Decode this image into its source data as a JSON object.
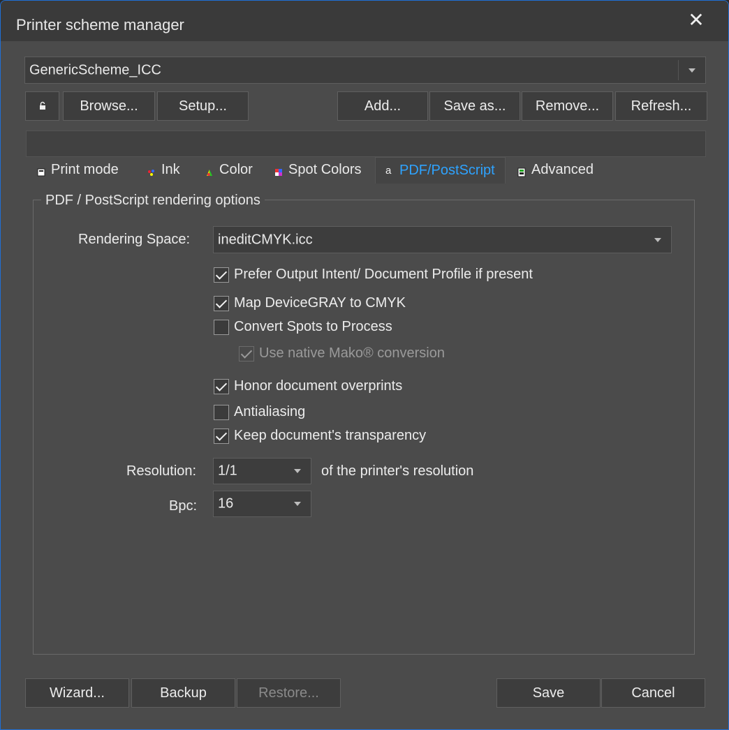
{
  "window": {
    "title": "Printer scheme manager",
    "close_glyph": "✕"
  },
  "scheme": {
    "selected": "GenericScheme_ICC"
  },
  "toolbar": {
    "lock_icon": "lock-icon",
    "browse": "Browse...",
    "setup": "Setup...",
    "add": "Add...",
    "save_as": "Save as...",
    "remove": "Remove...",
    "refresh": "Refresh..."
  },
  "tabs": [
    {
      "label": "Print mode",
      "icon": "printer-icon",
      "active": false
    },
    {
      "label": "Ink",
      "icon": "ink-drops-icon",
      "active": false
    },
    {
      "label": "Color",
      "icon": "color-wheel-icon",
      "active": false
    },
    {
      "label": "Spot Colors",
      "icon": "spot-colors-icon",
      "active": false
    },
    {
      "label": "PDF/PostScript",
      "icon": "pdf-glyph-icon",
      "active": true
    },
    {
      "label": "Advanced",
      "icon": "advanced-icon",
      "active": false
    }
  ],
  "group": {
    "title": "PDF / PostScript rendering options",
    "rendering_space_label": "Rendering Space:",
    "rendering_space_value": "ineditCMYK.icc",
    "options": [
      {
        "label": "Prefer Output Intent/ Document Profile if present",
        "checked": true,
        "enabled": true
      },
      {
        "label": "Map DeviceGRAY to CMYK",
        "checked": true,
        "enabled": true
      },
      {
        "label": "Convert Spots to Process",
        "checked": false,
        "enabled": true
      },
      {
        "label": "Use native Mako® conversion",
        "checked": true,
        "enabled": false
      },
      {
        "label": "Honor document overprints",
        "checked": true,
        "enabled": true
      },
      {
        "label": "Antialiasing",
        "checked": false,
        "enabled": true
      },
      {
        "label": "Keep document's transparency",
        "checked": true,
        "enabled": true
      }
    ],
    "resolution_label": "Resolution:",
    "resolution_value": "1/1",
    "resolution_suffix": "of the printer's resolution",
    "bpc_label": "Bpc:",
    "bpc_value": "16"
  },
  "footer": {
    "wizard": "Wizard...",
    "backup": "Backup",
    "restore": "Restore...",
    "save": "Save",
    "cancel": "Cancel"
  },
  "colors": {
    "accent": "#2ea3ff",
    "window_bg": "#4b4b4b",
    "titlebar_bg": "#3a3a3a",
    "border": "#1f6fd6"
  }
}
